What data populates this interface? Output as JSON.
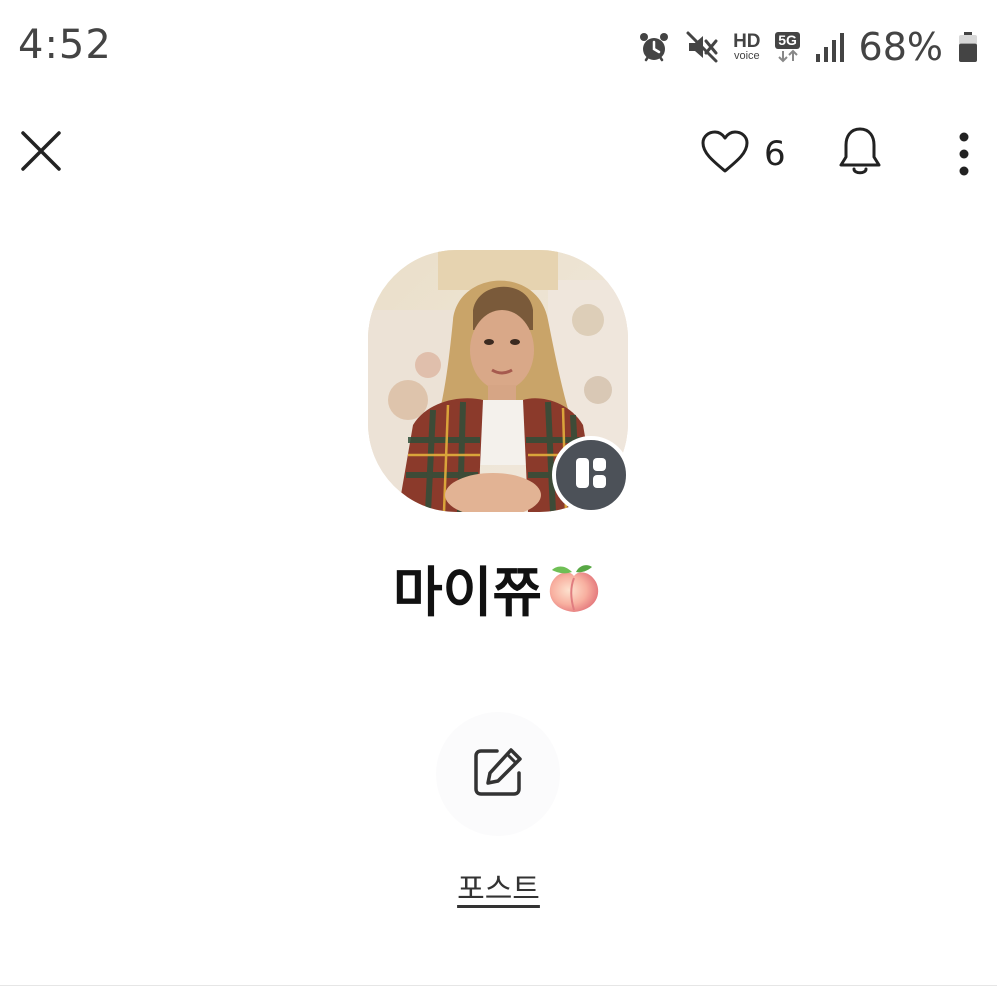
{
  "status_bar": {
    "time": "4:52",
    "icons": [
      "alarm-icon",
      "mute-icon",
      "hd-voice-icon",
      "5g-icon",
      "signal-icon",
      "battery-icon"
    ],
    "hd_label": "HD",
    "voice_label": "voice",
    "network_label": "5G",
    "battery_percent": "68%",
    "battery_level": 0.68
  },
  "top_bar": {
    "close_icon": "close-icon",
    "like_icon": "heart-icon",
    "like_count": "6",
    "notification_icon": "bell-icon",
    "more_icon": "more-vertical-icon"
  },
  "profile": {
    "name": "마이쮸",
    "name_emoji_icon": "peach-icon",
    "badge_icon": "channel-logo-icon"
  },
  "post": {
    "icon": "edit-icon",
    "label": "포스트"
  },
  "colors": {
    "badge_bg": "#4c5158",
    "text": "#111111",
    "status_text": "#444444"
  }
}
